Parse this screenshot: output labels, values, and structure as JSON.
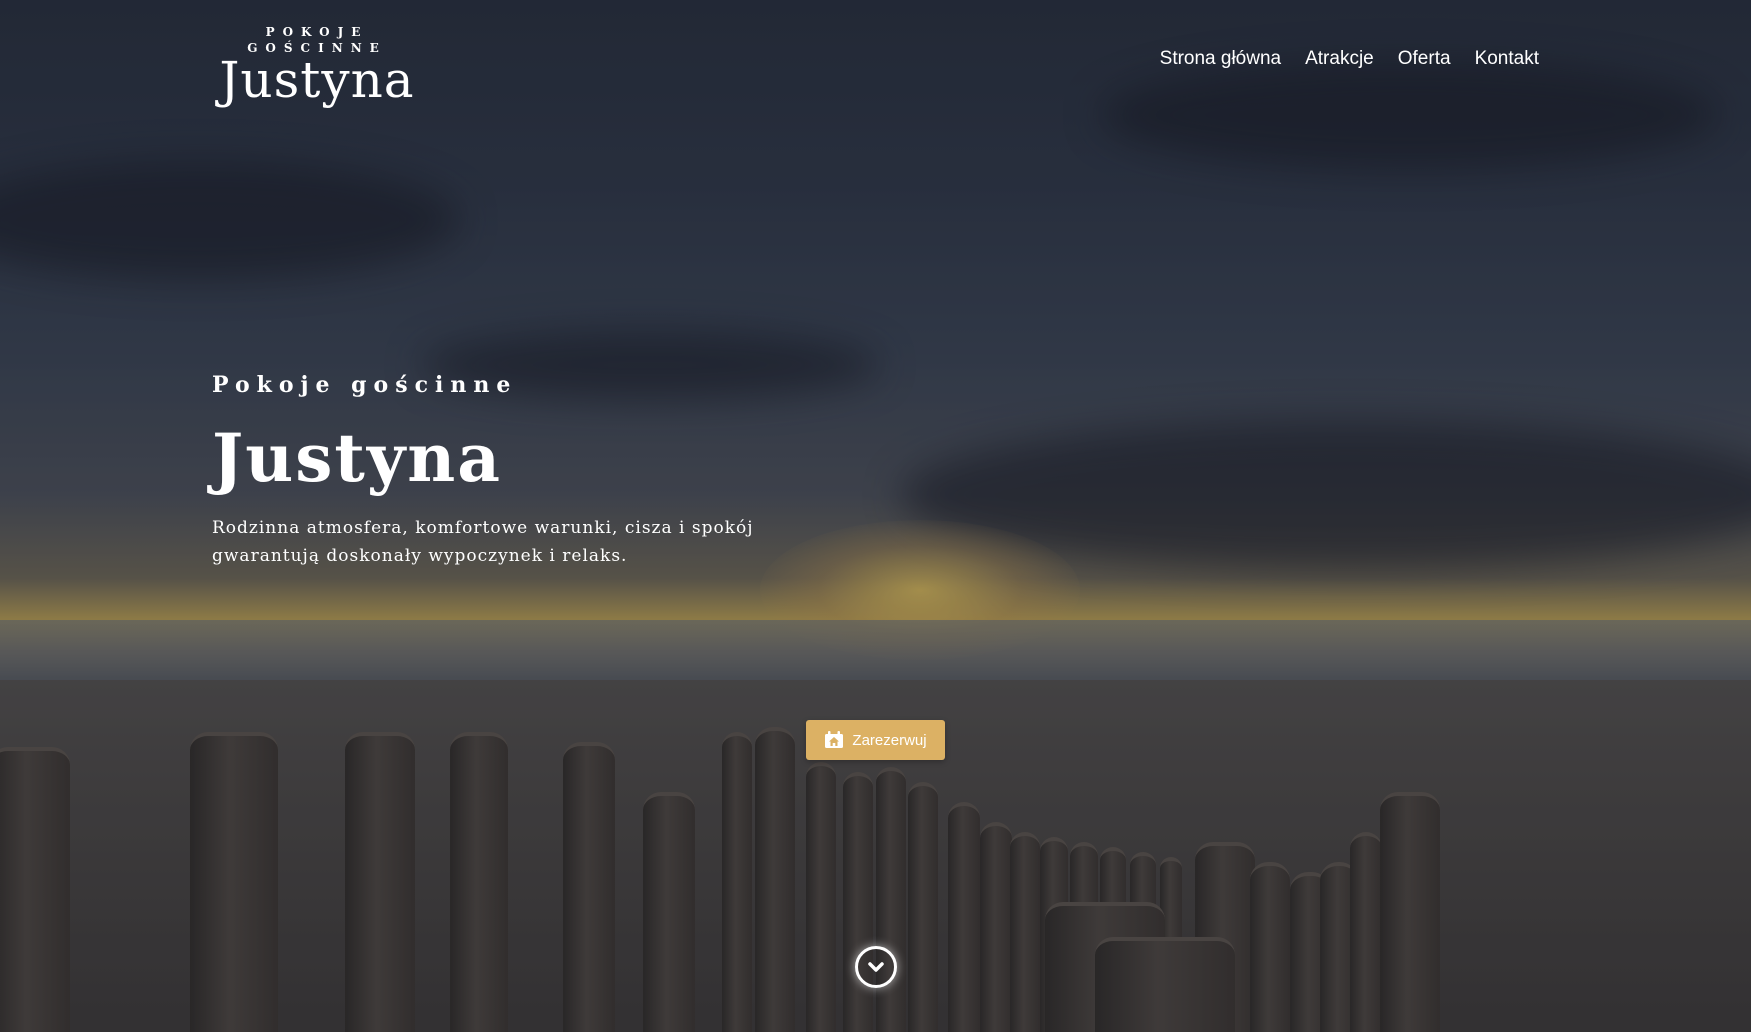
{
  "brand": {
    "small_line_1": "POKOJE",
    "small_line_2": "GOŚCINNE",
    "name": "Justyna"
  },
  "nav": {
    "items": [
      {
        "label": "Strona główna"
      },
      {
        "label": "Atrakcje"
      },
      {
        "label": "Oferta"
      },
      {
        "label": "Kontakt"
      }
    ]
  },
  "hero": {
    "eyebrow": "Pokoje gościnne",
    "headline": "Justyna",
    "lead": "Rodzinna atmosfera, komfortowe warunki, cisza i spokój gwarantują doskonały wypoczynek i relaks."
  },
  "cta": {
    "label": "Zarezerwuj",
    "icon": "house-calendar-icon"
  },
  "scroll": {
    "icon": "chevron-down-circle-icon"
  },
  "colors": {
    "accent": "#dcb164",
    "text": "#ffffff"
  },
  "background": {
    "description_icon": "beach-sunset-photo"
  }
}
